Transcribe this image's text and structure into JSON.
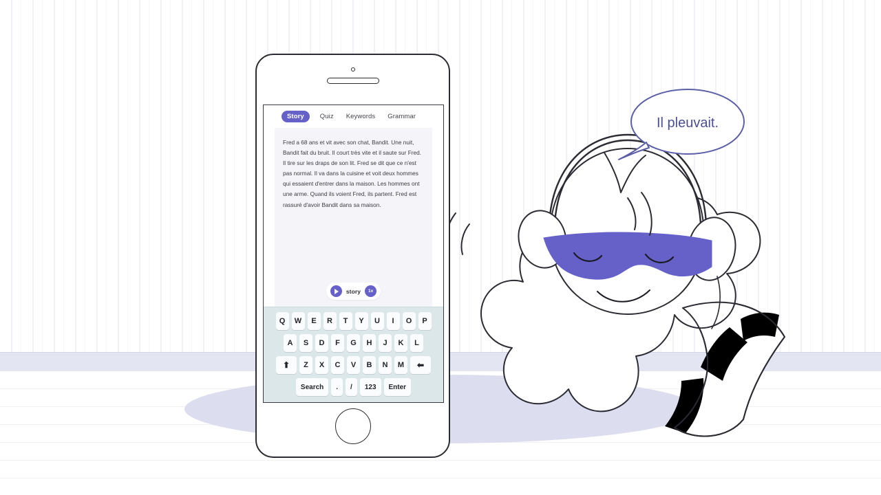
{
  "scene": {
    "background_wall_color": "#ffffff",
    "baseboard_color": "#e3e5f2",
    "floor_color": "#ffffff",
    "shadow_color": "#dcdef0"
  },
  "phone": {
    "device_label": "smartphone",
    "camera": "camera-dot",
    "speaker": "speaker-slot",
    "home_button": "home-button"
  },
  "app": {
    "tabs": [
      {
        "label": "Story",
        "active": true
      },
      {
        "label": "Quiz",
        "active": false
      },
      {
        "label": "Keywords",
        "active": false
      },
      {
        "label": "Grammar",
        "active": false
      }
    ],
    "story": {
      "text": "Fred a 68 ans et vit avec son chat, Bandit. Une nuit, Bandit fait du bruit. Il court très vite et il saute sur Fred. Il tire sur les draps de son lit. Fred se dit que ce n'est pas normal. Il va dans la cuisine et voit deux hommes qui essaient d'entrer dans la maison. Les hommes ont une arme. Quand ils voient Fred, ils partent. Fred est rassuré d'avoir Bandit dans sa maison."
    },
    "player": {
      "play_icon": "play-icon",
      "label": "story",
      "speed": "1x",
      "accent_color": "#6661c9"
    }
  },
  "keyboard": {
    "background_color": "#dce7ea",
    "row1": [
      "Q",
      "W",
      "E",
      "R",
      "T",
      "Y",
      "U",
      "I",
      "O",
      "P"
    ],
    "row2": [
      "A",
      "S",
      "D",
      "F",
      "G",
      "H",
      "J",
      "K",
      "L"
    ],
    "row3_shift": "⬆",
    "row3": [
      "Z",
      "X",
      "C",
      "V",
      "B",
      "N",
      "M"
    ],
    "row3_backspace": "⬅",
    "row4": [
      "Search",
      ".",
      "/",
      "123",
      "Enter"
    ]
  },
  "mascot": {
    "name": "star-mascot",
    "body_color": "#ffffff",
    "outline_color": "#2b2b33",
    "sleep_mask_color": "#6661c9",
    "tail_stripe_color": "#000000",
    "accessories": [
      "sleep-mask",
      "headphones",
      "striped-tail"
    ]
  },
  "speech_bubble": {
    "text": "Il pleuvait.",
    "outline_color": "#5a5fa8",
    "text_color": "#4a4f96"
  }
}
